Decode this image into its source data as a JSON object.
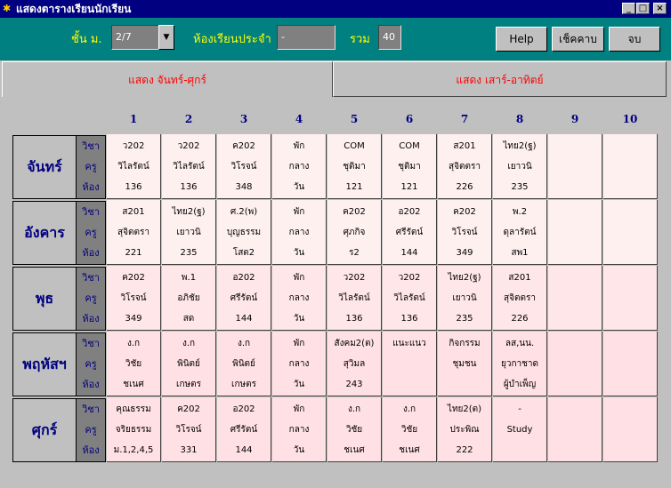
{
  "window": {
    "title": "แสดงตารางเรียนนักเรียน",
    "minimize": "_",
    "maximize": "□",
    "close": "×"
  },
  "toolbar": {
    "grade_label": "ชั้น ม.",
    "grade_value": "2/7",
    "homeroom_label": "ห้องเรียนประจำ",
    "homeroom_value": "-",
    "total_label": "รวม",
    "total_value": "40",
    "help_label": "Help",
    "check_label": "เช็คคาบ",
    "close_label": "จบ"
  },
  "tabs": [
    {
      "label": "แสดง จันทร์-ศุกร์",
      "active": true
    },
    {
      "label": "แสดง เสาร์-อาทิตย์",
      "active": false
    }
  ],
  "periods": [
    "1",
    "2",
    "3",
    "4",
    "5",
    "6",
    "7",
    "8",
    "9",
    "10"
  ],
  "row_labels": [
    "วิชา",
    "ครู",
    "ห้อง"
  ],
  "days": [
    {
      "name": "จันทร์",
      "color": "#fff0f0",
      "cells": [
        [
          "ว202",
          "วิไลรัตน์",
          "136"
        ],
        [
          "ว202",
          "วิไลรัตน์",
          "136"
        ],
        [
          "ค202",
          "วิโรจน์",
          "348"
        ],
        [
          "พัก",
          "กลาง",
          "วัน"
        ],
        [
          "COM",
          "ชุติมา",
          "121"
        ],
        [
          "COM",
          "ชุติมา",
          "121"
        ],
        [
          "ส201",
          "สุจิตตรา",
          "226"
        ],
        [
          "ไทย2(ฐ)",
          "เยาวนิ",
          "235"
        ],
        [
          "",
          "",
          ""
        ],
        [
          "",
          "",
          ""
        ]
      ]
    },
    {
      "name": "อังคาร",
      "color": "#fff0f0",
      "cells": [
        [
          "ส201",
          "สุจิตตรา",
          "221"
        ],
        [
          "ไทย2(ฐ)",
          "เยาวนิ",
          "235"
        ],
        [
          "ศ.2(พ)",
          "บุญธรรม",
          "โสต2"
        ],
        [
          "พัก",
          "กลาง",
          "วัน"
        ],
        [
          "ค202",
          "ศุภกิจ",
          "ร2"
        ],
        [
          "อ202",
          "ศรีรัตน์",
          "144"
        ],
        [
          "ค202",
          "วิโรจน์",
          "349"
        ],
        [
          "พ.2",
          "ดุลารัตน์",
          "สพ1"
        ],
        [
          "",
          "",
          ""
        ],
        [
          "",
          "",
          ""
        ]
      ]
    },
    {
      "name": "พุธ",
      "color": "#ffe6e8",
      "cells": [
        [
          "ค202",
          "วิโรจน์",
          "349"
        ],
        [
          "พ.1",
          "อภิชัย",
          "สด"
        ],
        [
          "อ202",
          "ศรีรัตน์",
          "144"
        ],
        [
          "พัก",
          "กลาง",
          "วัน"
        ],
        [
          "ว202",
          "วิไลรัตน์",
          "136"
        ],
        [
          "ว202",
          "วิไลรัตน์",
          "136"
        ],
        [
          "ไทย2(ฐ)",
          "เยาวนิ",
          "235"
        ],
        [
          "ส201",
          "สุจิตตรา",
          "226"
        ],
        [
          "",
          "",
          ""
        ],
        [
          "",
          "",
          ""
        ]
      ]
    },
    {
      "name": "พฤหัสฯ",
      "color": "#ffe0e4",
      "cells": [
        [
          "ง.ก",
          "วิชัย",
          "ชเนศ"
        ],
        [
          "ง.ก",
          "พินิตย์",
          "เกษตร"
        ],
        [
          "ง.ก",
          "พินิตย์",
          "เกษตร"
        ],
        [
          "พัก",
          "กลาง",
          "วัน"
        ],
        [
          "สังคม2(ต)",
          "สุวิมล",
          "243"
        ],
        [
          "แนะแนว",
          "",
          ""
        ],
        [
          "กิจกรรม",
          "ชุมชน",
          ""
        ],
        [
          "ลส,นน.",
          "ยุวกาชาด",
          "ผู้บำเพ็ญ"
        ],
        [
          "",
          "",
          ""
        ],
        [
          "",
          "",
          ""
        ]
      ]
    },
    {
      "name": "ศุกร์",
      "color": "#ffe0e4",
      "cells": [
        [
          "คุณธรรม",
          "จริยธรรม",
          "ม.1,2,4,5"
        ],
        [
          "ค202",
          "วิโรจน์",
          "331"
        ],
        [
          "อ202",
          "ศรีรัตน์",
          "144"
        ],
        [
          "พัก",
          "กลาง",
          "วัน"
        ],
        [
          "ง.ก",
          "วิชัย",
          "ชเนศ"
        ],
        [
          "ง.ก",
          "วิชัย",
          "ชเนศ"
        ],
        [
          "ไทย2(ต)",
          "ประพิณ",
          "222"
        ],
        [
          "-",
          "Study",
          ""
        ],
        [
          "",
          "",
          ""
        ],
        [
          "",
          "",
          ""
        ]
      ]
    }
  ]
}
